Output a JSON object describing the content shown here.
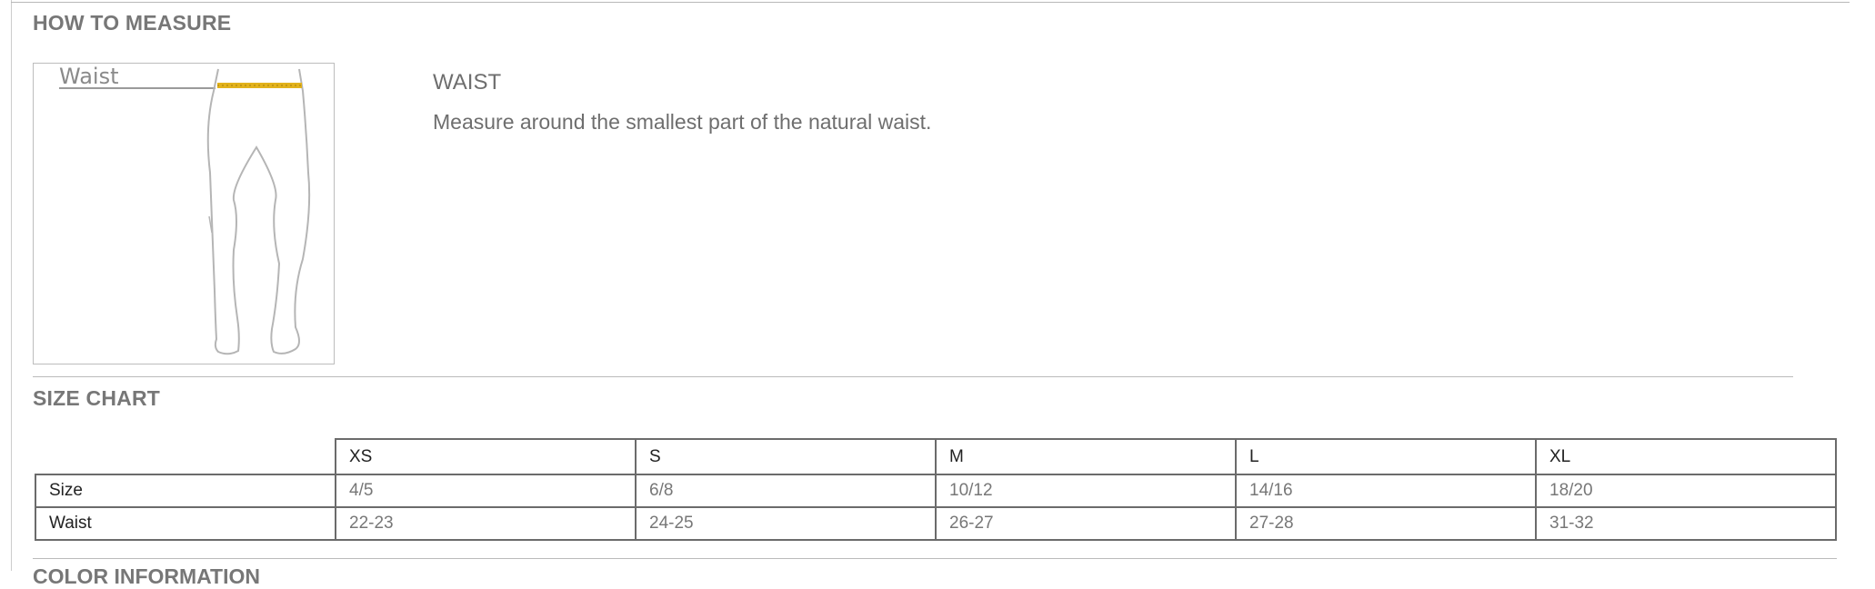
{
  "how_to_measure": {
    "heading": "HOW TO MEASURE",
    "figure_label": "Waist",
    "measure_title": "WAIST",
    "measure_description": "Measure around the smallest part of the natural waist."
  },
  "size_chart": {
    "heading": "SIZE CHART",
    "columns": [
      "XS",
      "S",
      "M",
      "L",
      "XL"
    ],
    "rows": [
      {
        "label": "Size",
        "values": [
          "4/5",
          "6/8",
          "10/12",
          "14/16",
          "18/20"
        ]
      },
      {
        "label": "Waist",
        "values": [
          "22-23",
          "24-25",
          "26-27",
          "27-28",
          "31-32"
        ]
      }
    ]
  },
  "next_section": {
    "heading": "COLOR INFORMATION"
  },
  "colors": {
    "tape_measure": "#e2b21c",
    "figure_outline": "#b5b5b5",
    "heading_text": "#777777",
    "table_border": "#6b6b6b"
  }
}
